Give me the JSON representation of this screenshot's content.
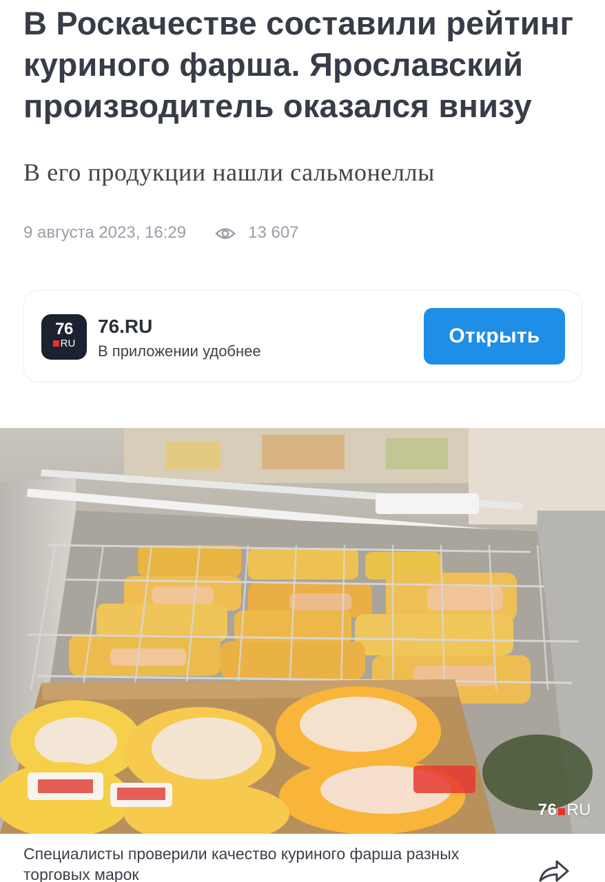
{
  "article": {
    "headline": "В Роскачестве составили рейтинг куриного фарша. Ярославский производитель оказался внизу",
    "subtitle": "В его продукции нашли сальмонеллы",
    "date": "9 августа 2023, 16:29",
    "views": "13 607",
    "views_icon": "eye-icon"
  },
  "app_banner": {
    "logo_number": "76",
    "logo_suffix": "RU",
    "name": "76.RU",
    "tagline": "В приложении удобнее",
    "open_label": "Открыть",
    "button_color": "#1f8ee6"
  },
  "photo": {
    "watermark_number": "76",
    "watermark_suffix": "RU",
    "description_icon": "photo-chicken-freezer"
  },
  "caption": {
    "text": "Специалисты проверили качество куриного фарша разных торговых марок",
    "share_icon": "share-icon"
  }
}
